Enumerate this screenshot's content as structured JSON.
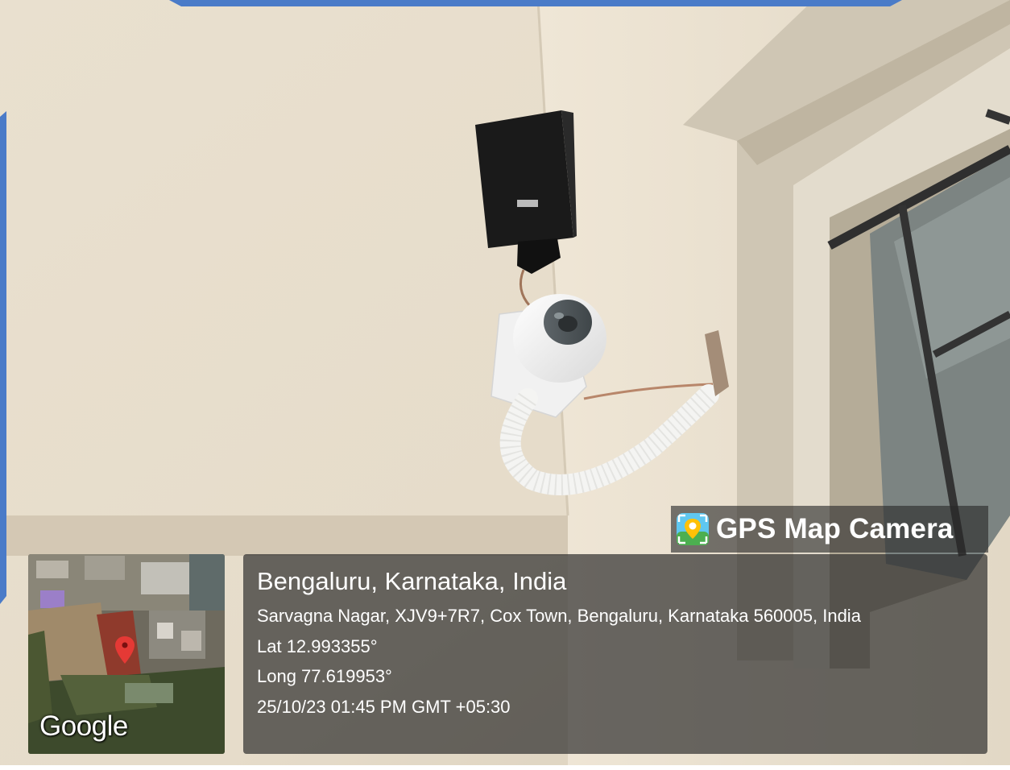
{
  "badge": {
    "label": "GPS Map Camera",
    "icon": "map-camera-icon"
  },
  "map": {
    "brand": "Google",
    "marker_color": "#e53935"
  },
  "location": {
    "city": "Bengaluru, Karnataka, India",
    "address": "Sarvagna Nagar, XJV9+7R7, Cox Town, Bengaluru, Karnataka 560005, India",
    "lat": "Lat 12.993355°",
    "long": "Long 77.619953°",
    "datetime": "25/10/23 01:45 PM GMT +05:30"
  },
  "colors": {
    "frame_accent": "#4a7bc8",
    "wall": "#ece3d3"
  }
}
